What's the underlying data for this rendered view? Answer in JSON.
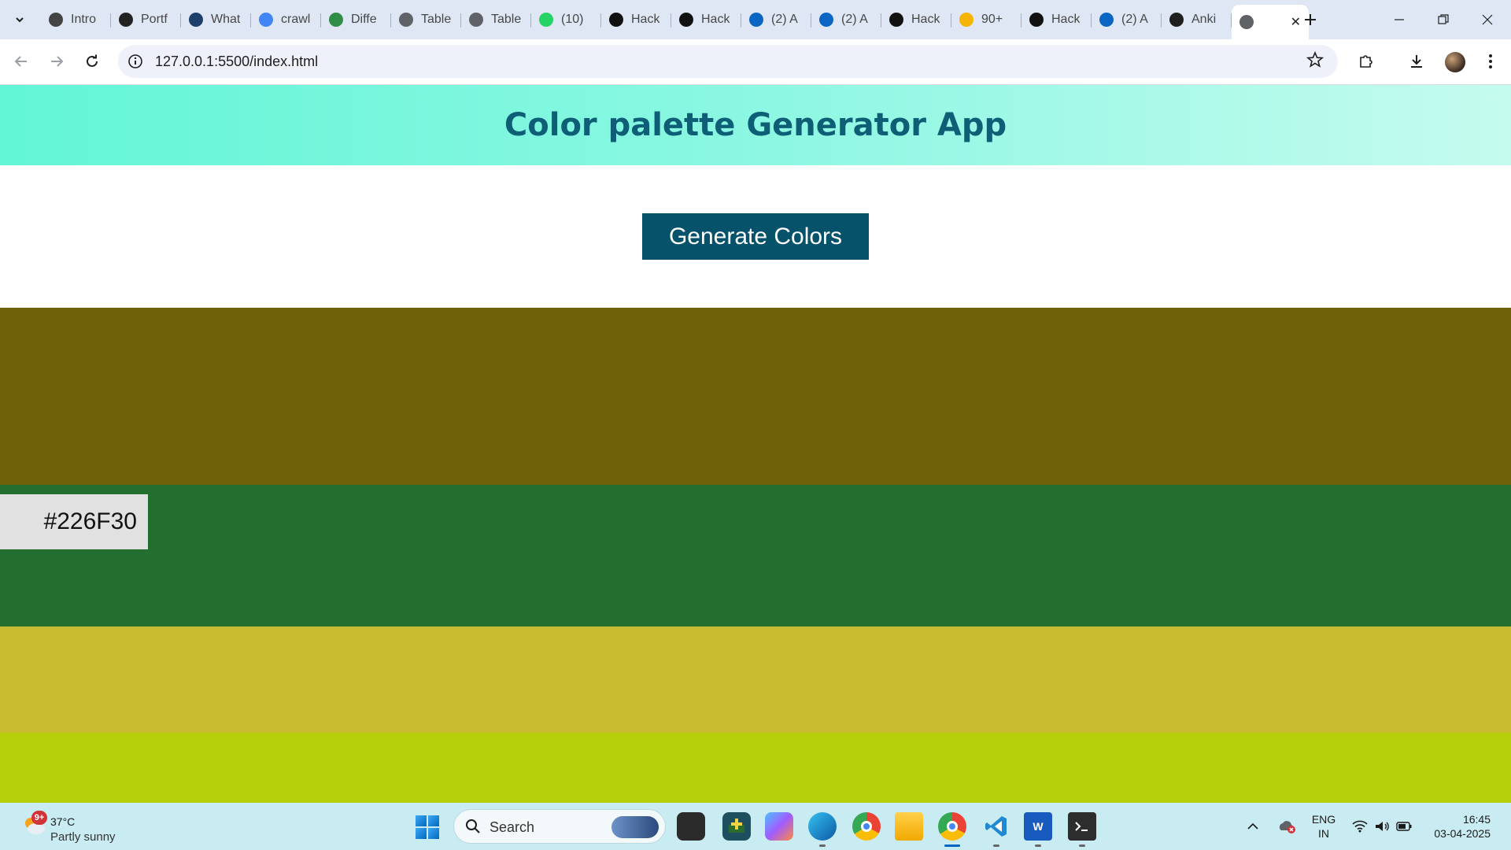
{
  "browser": {
    "tabs": [
      {
        "title": "Intro",
        "icon": "openai-icon",
        "color": "#444444"
      },
      {
        "title": "Portf",
        "icon": "openai-icon",
        "color": "#222222"
      },
      {
        "title": "What",
        "icon": "site-icon",
        "color": "#1e3f6b"
      },
      {
        "title": "crawl",
        "icon": "google-icon",
        "color": "#4285f4"
      },
      {
        "title": "Diffe",
        "icon": "gfg-icon",
        "color": "#2f8d46"
      },
      {
        "title": "Table",
        "icon": "globe-icon",
        "color": "#5f6368"
      },
      {
        "title": "Table",
        "icon": "globe-icon",
        "color": "#5f6368"
      },
      {
        "title": "(10)",
        "icon": "whatsapp-icon",
        "color": "#25d366"
      },
      {
        "title": "Hack",
        "icon": "hackerrank-icon",
        "color": "#111111"
      },
      {
        "title": "Hack",
        "icon": "hackerrank-icon",
        "color": "#111111"
      },
      {
        "title": "(2) A",
        "icon": "linkedin-icon",
        "color": "#0a66c2"
      },
      {
        "title": "(2) A",
        "icon": "linkedin-icon",
        "color": "#0a66c2"
      },
      {
        "title": "Hack",
        "icon": "hackerrank-icon",
        "color": "#111111"
      },
      {
        "title": "90+",
        "icon": "bookmark-icon",
        "color": "#f5b400"
      },
      {
        "title": "Hack",
        "icon": "hackerrank-icon",
        "color": "#111111"
      },
      {
        "title": "(2) A",
        "icon": "linkedin-icon",
        "color": "#0a66c2"
      },
      {
        "title": "Anki",
        "icon": "github-icon",
        "color": "#1f1f1f"
      }
    ],
    "active_tab": {
      "title": "",
      "icon": "globe-icon"
    },
    "url": "127.0.0.1:5500/index.html"
  },
  "app": {
    "title": "Color palette Generator App",
    "button_label": "Generate Colors",
    "palette": [
      {
        "color": "#6E610A",
        "hex_label": ""
      },
      {
        "color": "#226F30",
        "hex_label": "#226F30"
      },
      {
        "color": "#C8BC31",
        "hex_label": ""
      },
      {
        "color": "#B6D10B",
        "hex_label": ""
      }
    ]
  },
  "taskbar": {
    "weather": {
      "temp": "37°C",
      "condition": "Partly sunny",
      "badge": "9+"
    },
    "search_label": "Search",
    "apps": [
      "file-explorer-dark-icon",
      "contacts-icon",
      "copilot-icon",
      "edge-icon",
      "chrome-icon",
      "folder-icon",
      "chrome-icon",
      "vscode-icon",
      "word-icon",
      "terminal-icon"
    ],
    "lang_line1": "ENG",
    "lang_line2": "IN",
    "time": "16:45",
    "date": "03-04-2025"
  }
}
